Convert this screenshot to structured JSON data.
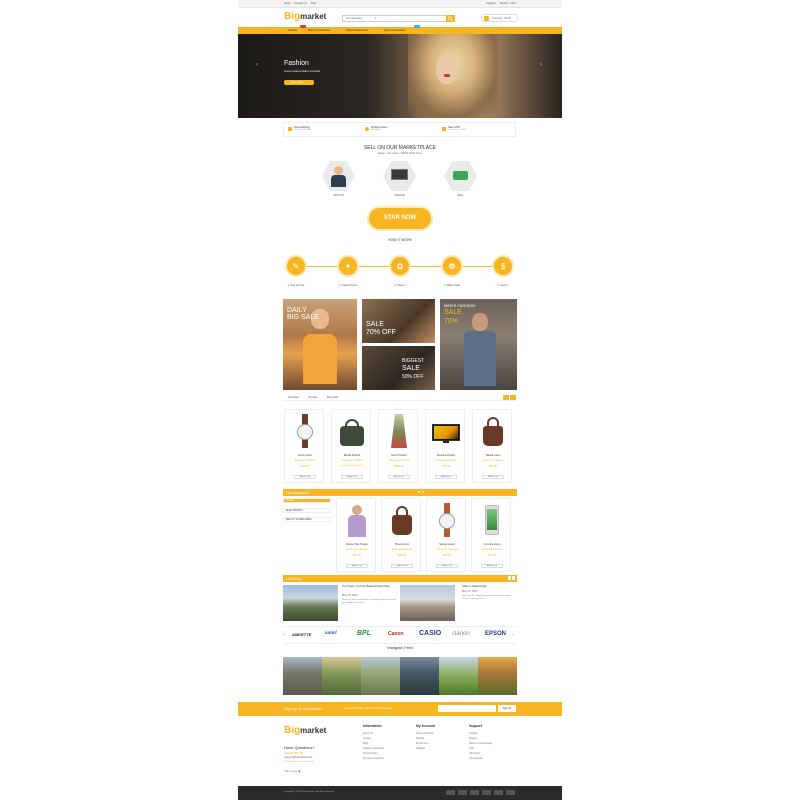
{
  "topbar": {
    "links": [
      "About",
      "Contact Us",
      "Blog"
    ],
    "right": [
      "Register",
      "English",
      "USD"
    ]
  },
  "header": {
    "logo_big": "Big",
    "logo_rest": "market",
    "search_category": "All Categories",
    "search_arrow": "▾",
    "cart_text": "0 item(s) - $0.00"
  },
  "nav": [
    "Fashion",
    "Beauty & Perfumes",
    "Digital & Electronic",
    "Sports & Outdoors"
  ],
  "hero": {
    "title": "Fashion",
    "subtitle": "Lorem ipsum dolor sit amet",
    "button": "Shop Now",
    "prev": "‹",
    "next": "›"
  },
  "shipping": [
    {
      "title": "Free shipping",
      "sub": "On orders over $99"
    },
    {
      "title": "30 days return",
      "sub": "Moneyback"
    },
    {
      "title": "Save 15%",
      "sub": "On orders over $200"
    }
  ],
  "marketplace": {
    "title": "SELL ON OUR MARKETPLACE",
    "subtitle": "Easy • No cost • 100% Risk Free",
    "items": [
      "SIGN UP",
      "CREATE",
      "SELL"
    ],
    "button": "STAR NOW"
  },
  "how": {
    "title": "HOW IT WORK",
    "steps": [
      "1. Sing Up Free",
      "2. Create Product",
      "3. Share it",
      "4. Make it Sale",
      "5. Cash in"
    ],
    "icons": [
      "✎",
      "✦",
      "✿",
      "⛃",
      "$"
    ]
  },
  "banners": {
    "b1": [
      "DAILY",
      "BIG SALE"
    ],
    "b2": [
      "SALE",
      "70% OFF"
    ],
    "b3": [
      "BIGGEST",
      "SALE",
      "50% OFF"
    ],
    "b4": [
      "MEN'S FASHION",
      "SALE",
      "70%"
    ]
  },
  "tabs": [
    "Top Rated",
    "Top Sale",
    "Best Seller"
  ],
  "products": [
    {
      "name": "Lorem Ipsum",
      "stars": "★★★★★ 1 Review",
      "price": "$100.00",
      "old": "$120.00",
      "btn": "Add to Cart"
    },
    {
      "name": "Bundle Product",
      "stars": "★★★★★ 1 Review",
      "price": "From $80.00 To $93.00",
      "old": "",
      "btn": "Add to Cart"
    },
    {
      "name": "Demo Product",
      "stars": "★★★★★ 1 Review",
      "price": "$100.00",
      "old": "$120.00",
      "btn": "Add to Cart"
    },
    {
      "name": "Grouped Product",
      "stars": "★★★★★ 0 Review",
      "price": "$70.00",
      "old": "",
      "btn": "Add to Cart"
    },
    {
      "name": "Tilltoed Lorum",
      "stars": "★★★★★ 1 Review",
      "price": "$90.00",
      "old": "",
      "btn": "Add to Cart"
    }
  ],
  "categories": {
    "title": "Top Categories",
    "menu": [
      "Fashion",
      "ELECTRONICS",
      "BEAUTY & PERFUMES"
    ],
    "products": [
      {
        "name": "Entere Trian Hoodie",
        "stars": "★★★★★ 0 Review",
        "price": "$32.00",
        "btn": "Add to Cart"
      },
      {
        "name": "Tiltoed Lorum",
        "stars": "★★★★★ 0 Review",
        "price": "$59.00",
        "btn": "Add to Cart"
      },
      {
        "name": "Samuel Lorum",
        "stars": "★★★★★ 0 Review",
        "price": "$65.00",
        "btn": "Add to Cart"
      },
      {
        "name": "Cucunbe Lorum",
        "stars": "★★★★★ 0 Review",
        "price": "$15.00",
        "btn": "Add to Cart"
      }
    ]
  },
  "news": {
    "title": "Last News",
    "items": [
      {
        "title": "The Power of a Pure-Based Product Plan",
        "date": "May 20, 2017",
        "views": "Views",
        "excerpt": "Stem non nam convertent in something you haven't had yet, would not be that..."
      },
      {
        "title": "Office in Digital Angle",
        "date": "May 20, 2017",
        "views": "Views",
        "excerpt": "Stem nec fee Sagapule person in rich that contain Victoria anything in bus..."
      }
    ]
  },
  "brands": [
    "AMKETTE",
    "iantel",
    "BPL",
    "Canon",
    "CASIO",
    "clarion",
    "EPSON"
  ],
  "instagram": {
    "title": "Instagram Feed"
  },
  "newsletter": {
    "title": "Sign up to Newsletter",
    "note": "...and receive $20 coupon for first shopping",
    "placeholder": "Your email address",
    "button": "Sign Up"
  },
  "footer": {
    "logo_big": "Big",
    "logo_rest": "market",
    "questions": "Have Questions?",
    "phone": "(+0123) 456 789",
    "email": "support@bigmarket.com",
    "note": "24/7 Dedicated Customer Support",
    "cols": [
      {
        "title": "Information",
        "links": [
          "About Us",
          "Contact",
          "Blog",
          "Delivery Information",
          "Privacy Policy",
          "Terms & Conditions"
        ]
      },
      {
        "title": "My Account",
        "links": [
          "Track your Order",
          "Wishlist",
          "My Account",
          "Affiliates"
        ]
      },
      {
        "title": "Support",
        "links": [
          "Security",
          "Privacy",
          "Returns & Exchanges",
          "Help",
          "Gift Cards",
          "International"
        ]
      }
    ]
  },
  "copyright": "Copyright © 2017 Bigmarket Inc. All rights reserved.",
  "colors": {
    "accent": "#f7b521",
    "dark": "#2b2b2b"
  }
}
